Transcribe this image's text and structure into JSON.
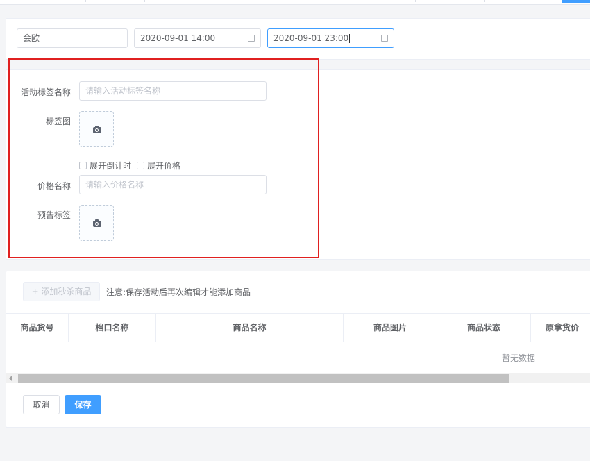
{
  "filters": {
    "name_value": "会欧",
    "start_time": "2020-09-01 14:00",
    "end_time": "2020-09-01 23:00"
  },
  "form": {
    "activity_tag_name_label": "活动标签名称",
    "activity_tag_name_placeholder": "请输入活动标签名称",
    "tag_image_label": "标签图",
    "show_countdown_label": "展开倒计时",
    "show_price_label": "展开价格",
    "price_name_label": "价格名称",
    "price_name_placeholder": "请输入价格名称",
    "presale_tag_label": "预告标签"
  },
  "goods": {
    "add_button_label": "+ 添加秒杀商品",
    "note": "注意:保存活动后再次编辑才能添加商品",
    "columns": [
      "商品货号",
      "档口名称",
      "商品名称",
      "商品图片",
      "商品状态",
      "原拿货价"
    ],
    "empty_text": "暂无数据"
  },
  "actions": {
    "cancel_label": "取消",
    "save_label": "保存"
  },
  "colors": {
    "primary": "#409eff",
    "highlight_border": "#e02020"
  },
  "icons": {
    "calendar": "calendar-icon",
    "camera": "camera-icon"
  }
}
